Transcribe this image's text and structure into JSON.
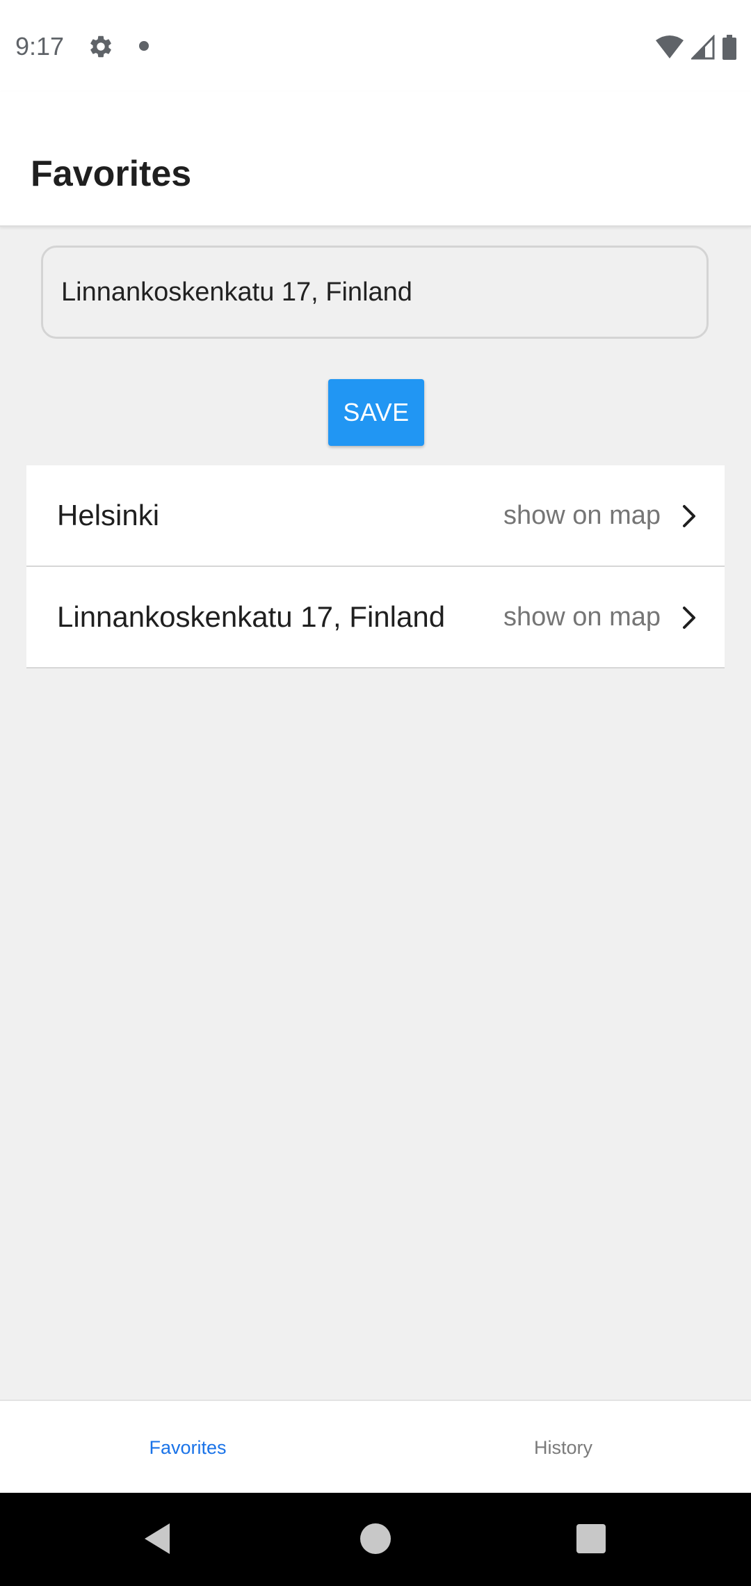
{
  "status_bar": {
    "time": "9:17",
    "left_icons": [
      "gear-icon",
      "notification-dot-icon"
    ],
    "right_icons": [
      "wifi-icon",
      "cell-signal-icon",
      "battery-icon"
    ]
  },
  "header": {
    "title": "Favorites"
  },
  "address_input": {
    "value": "Linnankoskenkatu 17, Finland"
  },
  "save_button": {
    "label": "SAVE",
    "color": "#2196f3"
  },
  "favorites": [
    {
      "name": "Helsinki",
      "action": "show on map"
    },
    {
      "name": "Linnankoskenkatu 17, Finland",
      "action": "show on map"
    }
  ],
  "bottom_tabs": [
    {
      "label": "Favorites",
      "active": true
    },
    {
      "label": "History",
      "active": false
    }
  ],
  "colors": {
    "accent": "#1a73e8",
    "background": "#f0f0f0"
  },
  "nav_bar": {
    "icons": [
      "back-icon",
      "home-icon",
      "recents-icon"
    ]
  }
}
